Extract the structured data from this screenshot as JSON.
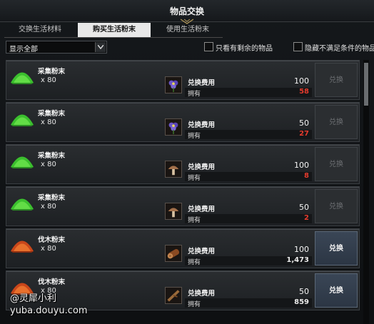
{
  "window": {
    "title": "物品交换"
  },
  "tabs": [
    {
      "label": "交换生活材料",
      "active": false
    },
    {
      "label": "购买生活粉末",
      "active": true
    },
    {
      "label": "使用生活粉末",
      "active": false
    }
  ],
  "filter": {
    "selected": "显示全部",
    "icon": "chevron-down-icon"
  },
  "checkboxes": [
    {
      "label": "只看有剩余的物品",
      "checked": false
    },
    {
      "label": "隐藏不满足条件的物品",
      "checked": false
    }
  ],
  "rows": [
    {
      "item_name": "采集粉末",
      "qty": "x 80",
      "item_icon": "green-powder-icon",
      "cost_icon": "purple-flower-icon",
      "cost_label": "兑换费用",
      "cost": "100",
      "own_label": "拥有",
      "owned": "58",
      "owned_color": "#e43b2d",
      "button": "兑换",
      "enabled": false
    },
    {
      "item_name": "采集粉末",
      "qty": "x 80",
      "item_icon": "green-powder-icon",
      "cost_icon": "purple-flower-icon",
      "cost_label": "兑换费用",
      "cost": "50",
      "own_label": "拥有",
      "owned": "27",
      "owned_color": "#e43b2d",
      "button": "兑换",
      "enabled": false
    },
    {
      "item_name": "采集粉末",
      "qty": "x 80",
      "item_icon": "green-powder-icon",
      "cost_icon": "mushroom-icon",
      "cost_label": "兑换费用",
      "cost": "100",
      "own_label": "拥有",
      "owned": "8",
      "owned_color": "#e43b2d",
      "button": "兑换",
      "enabled": false
    },
    {
      "item_name": "采集粉末",
      "qty": "x 80",
      "item_icon": "green-powder-icon",
      "cost_icon": "mushroom-icon",
      "cost_label": "兑换费用",
      "cost": "50",
      "own_label": "拥有",
      "owned": "2",
      "owned_color": "#e43b2d",
      "button": "兑换",
      "enabled": false
    },
    {
      "item_name": "伐木粉末",
      "qty": "x 80",
      "item_icon": "orange-powder-icon",
      "cost_icon": "log-icon",
      "cost_label": "兑换费用",
      "cost": "100",
      "own_label": "拥有",
      "owned": "1,473",
      "owned_color": "#eaeaea",
      "button": "兑换",
      "enabled": true
    },
    {
      "item_name": "伐木粉末",
      "qty": "x 80",
      "item_icon": "orange-powder-icon",
      "cost_icon": "branch-icon",
      "cost_label": "兑换费用",
      "cost": "50",
      "own_label": "拥有",
      "owned": "859",
      "owned_color": "#eaeaea",
      "button": "兑换",
      "enabled": true
    }
  ],
  "watermark": {
    "line1": "@灵犀小利",
    "line2": "yuba.douyu.com"
  }
}
